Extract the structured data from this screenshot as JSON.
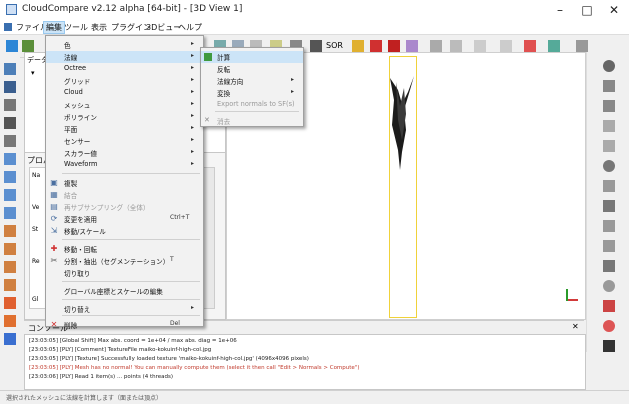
{
  "window": {
    "title": "CloudCompare v2.12 alpha [64-bit] - [3D View 1]",
    "min_label": "–",
    "max_label": "□",
    "close_label": "✕"
  },
  "menubar": {
    "items": [
      "ファイル",
      "編集",
      "ツール",
      "表示",
      "プラグイン",
      "3Dビュー",
      "ヘルプ"
    ],
    "active_index": 1
  },
  "toolbar": {
    "sor_label": "SOR"
  },
  "edit_menu": {
    "items": [
      {
        "label": "色",
        "arrow": "▸"
      },
      {
        "label": "法線",
        "arrow": "▸"
      },
      {
        "label": "Octree",
        "arrow": "▸"
      },
      {
        "label": "グリッド",
        "arrow": "▸"
      },
      {
        "label": "Cloud",
        "arrow": "▸"
      },
      {
        "label": "メッシュ",
        "arrow": "▸"
      },
      {
        "label": "ポリライン",
        "arrow": "▸"
      },
      {
        "label": "平面",
        "arrow": "▸"
      },
      {
        "label": "センサー",
        "arrow": "▸"
      },
      {
        "label": "スカラー値",
        "arrow": "▸"
      },
      {
        "label": "Waveform",
        "arrow": "▸"
      },
      {
        "label": "複製"
      },
      {
        "label": "結合"
      },
      {
        "label": "再サブサンプリング（全体）"
      },
      {
        "label": "変更を適用",
        "shortcut": "Ctrl+T"
      },
      {
        "label": "移動/スケール"
      },
      {
        "label": "移動・回転"
      },
      {
        "label": "分割・抽出（セグメンテーション）",
        "shortcut": "T"
      },
      {
        "label": "切り取り"
      },
      {
        "label": "グローバル座標とスケールの編集"
      },
      {
        "label": "切り替え",
        "arrow": "▸"
      },
      {
        "label": "削除",
        "shortcut": "Del"
      }
    ]
  },
  "normals_submenu": {
    "items": [
      {
        "label": "計算"
      },
      {
        "label": "反転"
      },
      {
        "label": "法線方向",
        "arrow": "▸"
      },
      {
        "label": "変換",
        "arrow": "▸"
      },
      {
        "label": "Export normals to SF(s)"
      },
      {
        "label": "消去"
      }
    ]
  },
  "panels": {
    "dbtree_title": "データ",
    "props_title": "プロパティ",
    "console_title": "コンソール",
    "props_rows": [
      "Na",
      "Ve",
      "St",
      "Re",
      "Gl"
    ]
  },
  "console": {
    "lines": [
      {
        "text": "[23:03:05] [Global Shift] Max abs. coord = 1e+04 / max abs. diag = 1e+06",
        "color": "#222222"
      },
      {
        "text": "[23:03:05] [PLY] [Comment] TextureFile maiko-kokuinf-high-col.jpg",
        "color": "#222222"
      },
      {
        "text": "[23:03:05] [PLY] [Texture] Successfully loaded texture 'maiko-kokuinf-high-col.jpg' (4096x4096 pixels)",
        "color": "#222222"
      },
      {
        "text": "[23:03:05] [PLY] Mesh has no normal! You can manually compute them (select it then call \"Edit > Normals > Compute\")",
        "color": "#c0392b"
      },
      {
        "text": "[23:03:06] [PLY] Read 1 item(s) ... points (4 threads)",
        "color": "#222222"
      }
    ]
  },
  "status": {
    "text": "選択されたメッシュに法線を計算します（面または頂点）"
  },
  "colors": {
    "highlight": "#cce4f7",
    "bbox": "#f0d23a",
    "error_text": "#c0392b"
  }
}
